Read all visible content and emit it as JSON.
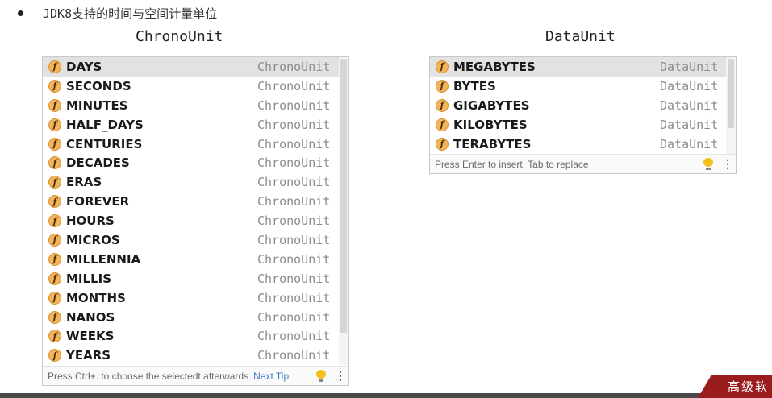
{
  "heading": "JDK8支持的时间与空间计量单位",
  "chrono": {
    "title": "ChronoUnit",
    "items": [
      {
        "name": "DAYS",
        "type": "ChronoUnit"
      },
      {
        "name": "SECONDS",
        "type": "ChronoUnit"
      },
      {
        "name": "MINUTES",
        "type": "ChronoUnit"
      },
      {
        "name": "HALF_DAYS",
        "type": "ChronoUnit"
      },
      {
        "name": "CENTURIES",
        "type": "ChronoUnit"
      },
      {
        "name": "DECADES",
        "type": "ChronoUnit"
      },
      {
        "name": "ERAS",
        "type": "ChronoUnit"
      },
      {
        "name": "FOREVER",
        "type": "ChronoUnit"
      },
      {
        "name": "HOURS",
        "type": "ChronoUnit"
      },
      {
        "name": "MICROS",
        "type": "ChronoUnit"
      },
      {
        "name": "MILLENNIA",
        "type": "ChronoUnit"
      },
      {
        "name": "MILLIS",
        "type": "ChronoUnit"
      },
      {
        "name": "MONTHS",
        "type": "ChronoUnit"
      },
      {
        "name": "NANOS",
        "type": "ChronoUnit"
      },
      {
        "name": "WEEKS",
        "type": "ChronoUnit"
      },
      {
        "name": "YEARS",
        "type": "ChronoUnit"
      }
    ],
    "footer": "Press Ctrl+. to choose the selectedt afterwards",
    "footer_link": "Next Tip"
  },
  "data": {
    "title": "DataUnit",
    "items": [
      {
        "name": "MEGABYTES",
        "type": "DataUnit"
      },
      {
        "name": "BYTES",
        "type": "DataUnit"
      },
      {
        "name": "GIGABYTES",
        "type": "DataUnit"
      },
      {
        "name": "KILOBYTES",
        "type": "DataUnit"
      },
      {
        "name": "TERABYTES",
        "type": "DataUnit"
      }
    ],
    "footer": "Press Enter to insert, Tab to replace"
  },
  "field_icon_letter": "f",
  "icon_names": {
    "field": "field-icon",
    "bulb": "lightbulb-icon",
    "menu": "more-vertical-icon"
  },
  "colors": {
    "selected_row": "#e2e2e2",
    "field_icon": "#f3b45c",
    "link": "#3a78c8",
    "tag": "#9b1c1c"
  },
  "corner_tag": "高级软"
}
